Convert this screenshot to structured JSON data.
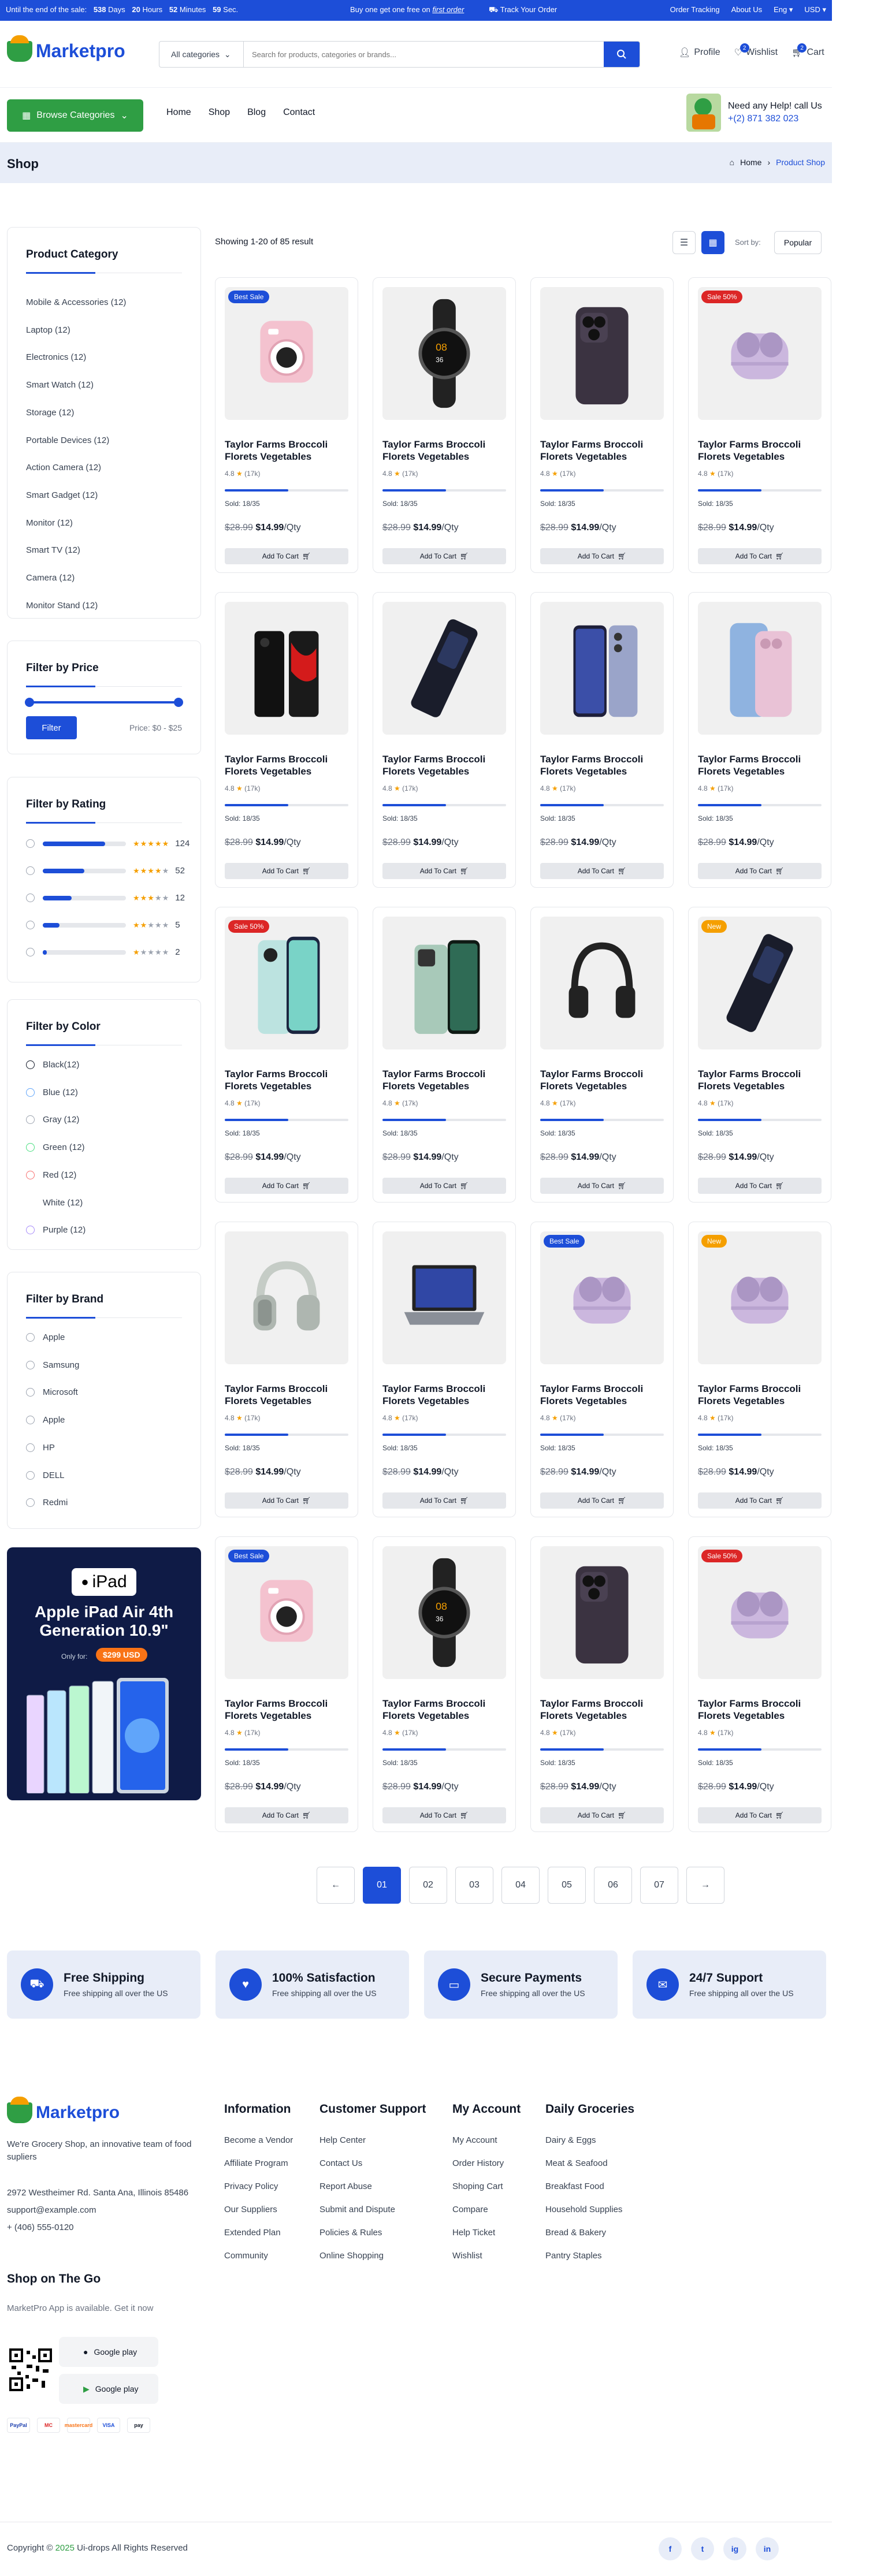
{
  "topbar": {
    "promo": "Until the end of the sale:",
    "days_n": "538",
    "days": "Days",
    "hours_n": "20",
    "hours": "Hours",
    "min_n": "52",
    "min": "Minutes",
    "sec_n": "59",
    "sec": "Sec.",
    "offer_prefix": "Buy one get one free on",
    "offer_link": "first order",
    "track": "Track Your Order",
    "links": [
      "Order Tracking",
      "About Us",
      "Eng",
      "USD"
    ]
  },
  "header": {
    "brand": "Marketpro",
    "category_select": "All categories",
    "search_placeholder": "Search for products, categories or brands...",
    "profile": "Profile",
    "wishlist": "Wishlist",
    "wishlist_count": "2",
    "cart": "Cart",
    "cart_count": "2"
  },
  "nav": {
    "browse": "Browse Categories",
    "links": [
      "Home",
      "Shop",
      "Blog",
      "Contact"
    ],
    "help_label": "Need any Help! call Us",
    "help_phone": "+(2) 871 382 023"
  },
  "page": {
    "title": "Shop",
    "crumb_home": "Home",
    "crumb_current": "Product Shop"
  },
  "category": {
    "title": "Product Category",
    "items": [
      "Mobile & Accessories (12)",
      "Laptop (12)",
      "Electronics (12)",
      "Smart Watch (12)",
      "Storage (12)",
      "Portable Devices (12)",
      "Action Camera (12)",
      "Smart Gadget (12)",
      "Monitor (12)",
      "Smart TV (12)",
      "Camera (12)",
      "Monitor Stand (12)"
    ]
  },
  "price": {
    "title": "Filter by Price",
    "button": "Filter",
    "range": "Price: $0 - $25"
  },
  "rating": {
    "title": "Filter by Rating",
    "rows": [
      {
        "stars": 5,
        "pct": 0.75,
        "count": "124"
      },
      {
        "stars": 4,
        "pct": 0.5,
        "count": "52"
      },
      {
        "stars": 3,
        "pct": 0.35,
        "count": "12"
      },
      {
        "stars": 2,
        "pct": 0.2,
        "count": "5"
      },
      {
        "stars": 1,
        "pct": 0.05,
        "count": "2"
      }
    ]
  },
  "color": {
    "title": "Filter by Color",
    "items": [
      {
        "label": "Black(12)",
        "color": "#111827"
      },
      {
        "label": "Blue (12)",
        "color": "#60a5fa"
      },
      {
        "label": "Gray (12)",
        "color": "#9ca3af"
      },
      {
        "label": "Green (12)",
        "color": "#4ade80"
      },
      {
        "label": "Red (12)",
        "color": "#f87171"
      },
      {
        "label": "White (12)",
        "color": "#ffffff"
      },
      {
        "label": "Purple (12)",
        "color": "#a78bfa"
      }
    ]
  },
  "brand": {
    "title": "Filter by Brand",
    "items": [
      "Apple",
      "Samsung",
      "Microsoft",
      "Apple",
      "HP",
      "DELL",
      "Redmi"
    ]
  },
  "ipad": {
    "logo": "iPad",
    "title": "Apple iPad Air 4th Generation 10.9\"",
    "only_for": "Only for:",
    "price": "$299 USD"
  },
  "toolbar": {
    "showing": "Showing 1-20 of 85 result",
    "sort_label": "Sort by:",
    "sort_value": "Popular"
  },
  "product": {
    "name": "Taylor Farms Broccoli Florets Vegetables",
    "rating": "4.8",
    "reviews": "(17k)",
    "sold": "Sold: 18/35",
    "old_price": "$28.99",
    "price": "$14.99",
    "unit": "/Qty",
    "cart": "Add To Cart"
  },
  "products": [
    {
      "img": "camera",
      "badge": "Best Sale",
      "badge_color": "#1d4ed8"
    },
    {
      "img": "watch",
      "badge": "",
      "badge_color": ""
    },
    {
      "img": "iphone",
      "badge": "",
      "badge_color": ""
    },
    {
      "img": "buds",
      "badge": "Sale 50%",
      "badge_color": "#dc2626"
    },
    {
      "img": "xiaomi",
      "badge": "",
      "badge_color": ""
    },
    {
      "img": "phonex",
      "badge": "",
      "badge_color": ""
    },
    {
      "img": "s23",
      "badge": "",
      "badge_color": ""
    },
    {
      "img": "iphone15",
      "badge": "",
      "badge_color": ""
    },
    {
      "img": "vivo",
      "badge": "Sale 50%",
      "badge_color": "#dc2626"
    },
    {
      "img": "mi13",
      "badge": "",
      "badge_color": ""
    },
    {
      "img": "headphone",
      "badge": "",
      "badge_color": ""
    },
    {
      "img": "phonex",
      "badge": "New",
      "badge_color": "#f59f00"
    },
    {
      "img": "airpodsmax",
      "badge": "",
      "badge_color": ""
    },
    {
      "img": "laptop",
      "badge": "",
      "badge_color": ""
    },
    {
      "img": "buds",
      "badge": "Best Sale",
      "badge_color": "#1d4ed8"
    },
    {
      "img": "buds",
      "badge": "New",
      "badge_color": "#f59f00"
    },
    {
      "img": "camera",
      "badge": "Best Sale",
      "badge_color": "#1d4ed8"
    },
    {
      "img": "watch",
      "badge": "",
      "badge_color": ""
    },
    {
      "img": "iphone",
      "badge": "",
      "badge_color": ""
    },
    {
      "img": "buds",
      "badge": "Sale 50%",
      "badge_color": "#dc2626"
    }
  ],
  "pagination": {
    "prev": "←",
    "pages": [
      "01",
      "02",
      "03",
      "04",
      "05",
      "06",
      "07"
    ],
    "next": "→"
  },
  "features": [
    {
      "title": "Free Shipping",
      "text": "Free shipping all over the US"
    },
    {
      "title": "100% Satisfaction",
      "text": "Free shipping all over the US"
    },
    {
      "title": "Secure Payments",
      "text": "Free shipping all over the US"
    },
    {
      "title": "24/7 Support",
      "text": "Free shipping all over the US"
    }
  ],
  "footer": {
    "about": "We're Grocery Shop, an innovative team of food supliers",
    "address": "2972 Westheimer Rd. Santa Ana, Illinois 85486",
    "email": "support@example.com",
    "phone": "+ (406) 555-0120",
    "columns": [
      {
        "title": "Information",
        "items": [
          "Become a Vendor",
          "Affiliate Program",
          "Privacy Policy",
          "Our Suppliers",
          "Extended Plan",
          "Community"
        ]
      },
      {
        "title": "Customer Support",
        "items": [
          "Help Center",
          "Contact Us",
          "Report Abuse",
          "Submit and Dispute",
          "Policies & Rules",
          "Online Shopping"
        ]
      },
      {
        "title": "My Account",
        "items": [
          "My Account",
          "Order History",
          "Shoping Cart",
          "Compare",
          "Help Ticket",
          "Wishlist"
        ]
      },
      {
        "title": "Daily Groceries",
        "items": [
          "Dairy & Eggs",
          "Meat & Seafood",
          "Breakfast Food",
          "Household Supplies",
          "Bread & Bakery",
          "Pantry Staples"
        ]
      }
    ],
    "app_title": "Shop on The Go",
    "app_text": "MarketPro App is available. Get it now",
    "google_play": "Google play",
    "payments": [
      "PayPal",
      "MC",
      "mastercard",
      "VISA",
      "pay"
    ],
    "copyright_prefix": "Copyright ©",
    "copyright_year": "2025",
    "copyright_rest": "Ui-drops All Rights Reserved",
    "socials": [
      "f",
      "t",
      "ig",
      "in"
    ]
  }
}
